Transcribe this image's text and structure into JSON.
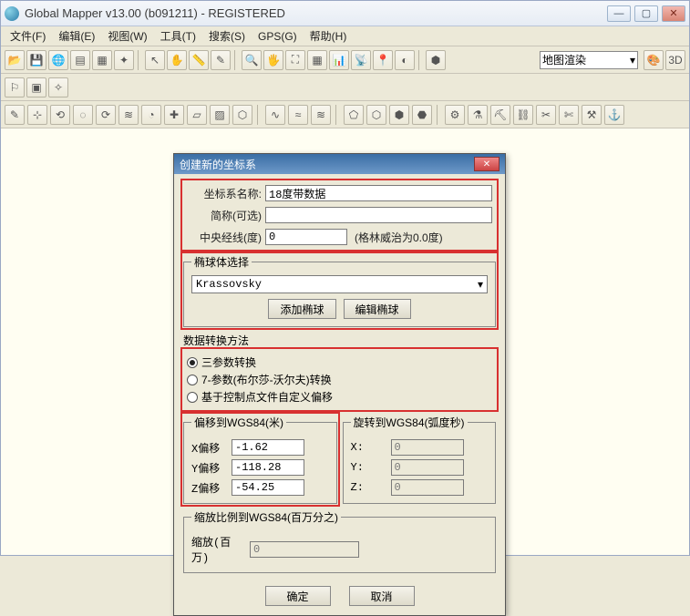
{
  "window": {
    "title": "Global Mapper v13.00 (b091211) - REGISTERED"
  },
  "menu": {
    "file": "文件(F)",
    "edit": "编辑(E)",
    "view": "视图(W)",
    "tools": "工具(T)",
    "search": "搜索(S)",
    "gps": "GPS(G)",
    "help": "帮助(H)"
  },
  "toolbar": {
    "maprender_label": "地图渲染",
    "dropdown_arrow": "▾"
  },
  "dialog": {
    "title": "创建新的坐标系",
    "name_label": "坐标系名称:",
    "name_value": "18度带数据",
    "abbr_label": "简称(可选)",
    "abbr_value": "",
    "cm_label": "中央经线(度)",
    "cm_value": "0",
    "cm_hint": "(格林威治为0.0度)",
    "ellipsoid": {
      "legend": "椭球体选择",
      "selected": "Krassovsky",
      "add_btn": "添加椭球",
      "edit_btn": "编辑椭球"
    },
    "datum_transform": {
      "legend": "数据转换方法",
      "opt1": "三参数转换",
      "opt2": "7-参数(布尔莎-沃尔夫)转换",
      "opt3": "基于控制点文件自定义偏移"
    },
    "offset": {
      "legend": "偏移到WGS84(米)",
      "x_label": "X偏移",
      "x_value": "-1.62",
      "y_label": "Y偏移",
      "y_value": "-118.28",
      "z_label": "Z偏移",
      "z_value": "-54.25"
    },
    "rotation": {
      "legend": "旋转到WGS84(弧度秒)",
      "x_label": "X:",
      "x_value": "0",
      "y_label": "Y:",
      "y_value": "0",
      "z_label": "Z:",
      "z_value": "0"
    },
    "scale": {
      "legend": "缩放比例到WGS84(百万分之)",
      "label": "缩放(百万)",
      "value": "0"
    },
    "ok": "确定",
    "cancel": "取消"
  }
}
